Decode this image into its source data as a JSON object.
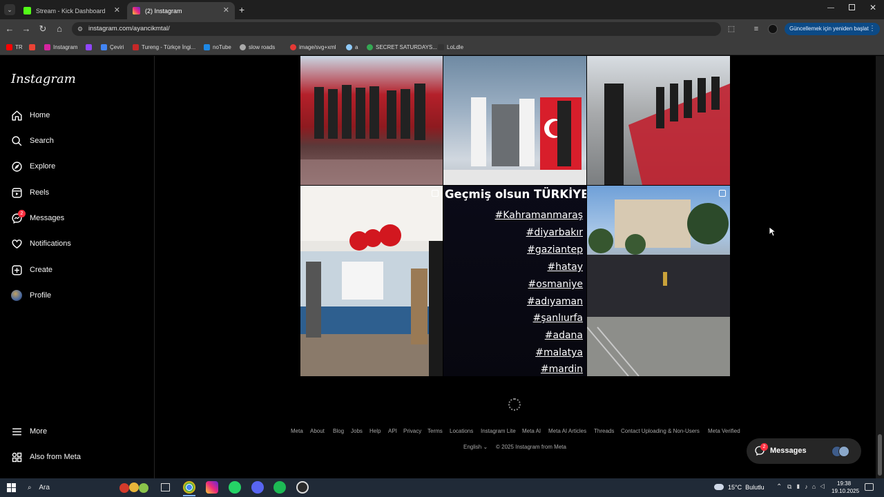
{
  "browser": {
    "tabs": [
      {
        "label": "Stream - Kick Dashboard",
        "icon": "kick-icon",
        "active": false
      },
      {
        "label": "(2) Instagram",
        "icon": "instagram-icon",
        "active": true
      }
    ],
    "url": "instagram.com/ayancikmtal/",
    "update_button": "Güncellemek için yeniden başlat",
    "bookmarks": [
      {
        "label": "TR",
        "icon": "youtube-icon",
        "color": "#ff0000"
      },
      {
        "label": "",
        "icon": "gmail-icon",
        "color": "#ea4335"
      },
      {
        "label": "Instagram",
        "icon": "instagram-icon",
        "color": "#d6249f"
      },
      {
        "label": "",
        "icon": "twitch-icon",
        "color": "#9146ff"
      },
      {
        "label": "Çeviri",
        "icon": "translate-icon",
        "color": "#4285f4"
      },
      {
        "label": "Tureng - Türkçe İngi...",
        "icon": "tureng-icon",
        "color": "#c62828"
      },
      {
        "label": "noTube",
        "icon": "notube-icon",
        "color": "#1e88e5"
      },
      {
        "label": "slow roads",
        "icon": "slowroads-icon",
        "color": "#aaaaaa"
      },
      {
        "label": "image/svg+xml",
        "icon": "svg-icon",
        "color": "#e53935"
      },
      {
        "label": "a",
        "icon": "a-icon",
        "color": "#90caf9"
      },
      {
        "label": "SECRET SATURDAYS...",
        "icon": "google-icon",
        "color": "#34a853"
      },
      {
        "label": "LoLdle",
        "icon": "loldle-icon",
        "color": "#333333"
      }
    ]
  },
  "instagram": {
    "logo": "Instagram",
    "nav": [
      {
        "label": "Home",
        "icon": "home-icon"
      },
      {
        "label": "Search",
        "icon": "search-icon"
      },
      {
        "label": "Explore",
        "icon": "compass-icon"
      },
      {
        "label": "Reels",
        "icon": "reels-icon"
      },
      {
        "label": "Messages",
        "icon": "messenger-icon",
        "badge": "2"
      },
      {
        "label": "Notifications",
        "icon": "heart-icon"
      },
      {
        "label": "Create",
        "icon": "plus-square-icon"
      },
      {
        "label": "Profile",
        "icon": "avatar-icon"
      }
    ],
    "more": "More",
    "also_from_meta": "Also from Meta",
    "post_text": {
      "title": "Geçmiş olsun TÜRKİYE",
      "hashtags": [
        "#Kahramanmaraş",
        "#diyarbakır",
        "#gaziantep",
        "#hatay",
        "#osmaniye",
        "#adıyaman",
        "#şanlıurfa",
        "#adana",
        "#malatya",
        "#mardin"
      ]
    },
    "footer_links": [
      "Meta",
      "About",
      "Blog",
      "Jobs",
      "Help",
      "API",
      "Privacy",
      "Terms",
      "Locations",
      "Instagram Lite",
      "Meta AI",
      "Meta AI Articles",
      "Threads",
      "Contact Uploading & Non-Users",
      "Meta Verified"
    ],
    "language": "English",
    "copyright": "© 2025 Instagram from Meta",
    "messages_button": {
      "label": "Messages",
      "badge": "2"
    }
  },
  "taskbar": {
    "search": "Ara",
    "weather": "15°C  Bulutlu",
    "time": "19:38",
    "date": "19.10.2025"
  }
}
